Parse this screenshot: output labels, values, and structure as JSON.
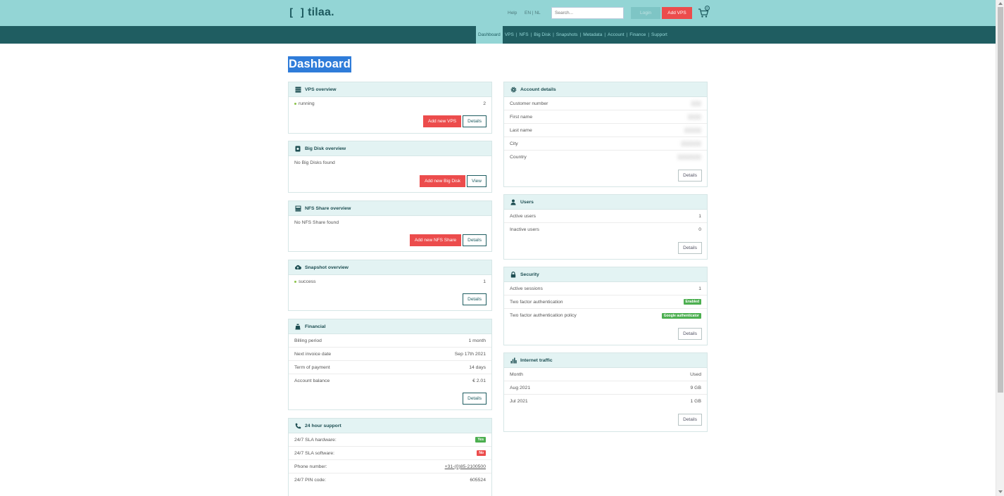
{
  "header": {
    "logo_text": "tilaa.",
    "help": "Help",
    "languages": "EN | NL",
    "search_placeholder": "Search...",
    "login_label": "Login",
    "add_vps_label": "Add VPS",
    "cart_count": "0"
  },
  "nav": {
    "items": [
      "Dashboard",
      "VPS",
      "NFS",
      "Big Disk",
      "Snapshots",
      "Metadata",
      "Account",
      "Finance",
      "Support"
    ]
  },
  "page": {
    "title": "Dashboard"
  },
  "vps": {
    "title": "VPS overview",
    "rows": [
      {
        "label": "running",
        "value": "2"
      }
    ],
    "add_label": "Add new VPS",
    "details_label": "Details"
  },
  "bigdisk": {
    "title": "Big Disk overview",
    "empty": "No Big Disks found",
    "add_label": "Add new Big Disk",
    "view_label": "View"
  },
  "nfs": {
    "title": "NFS Share overview",
    "empty": "No NFS Share found",
    "add_label": "Add new NFS Share",
    "details_label": "Details"
  },
  "snapshot": {
    "title": "Snapshot overview",
    "rows": [
      {
        "label": "success",
        "value": "1"
      }
    ],
    "details_label": "Details"
  },
  "financial": {
    "title": "Financial",
    "rows": [
      {
        "label": "Billing period",
        "value": "1 month"
      },
      {
        "label": "Next invoice date",
        "value": "Sep 17th 2021"
      },
      {
        "label": "Term of payment",
        "value": "14 days"
      },
      {
        "label": "Account balance",
        "value": "€ 2.01"
      }
    ],
    "details_label": "Details"
  },
  "support": {
    "title": "24 hour support",
    "rows": [
      {
        "label": "24/7 SLA hardware:",
        "value": "Yes"
      },
      {
        "label": "24/7 SLA software:",
        "value": "No"
      },
      {
        "label": "Phone number:",
        "value": "+31-(0)85-2100500"
      },
      {
        "label": "24/7 PIN code:",
        "value": "605524"
      }
    ]
  },
  "account": {
    "title": "Account details",
    "rows": [
      {
        "label": "Customer number",
        "value": ""
      },
      {
        "label": "First name",
        "value": ""
      },
      {
        "label": "Last name",
        "value": ""
      },
      {
        "label": "City",
        "value": ""
      },
      {
        "label": "Country",
        "value": ""
      }
    ],
    "details_label": "Details"
  },
  "users": {
    "title": "Users",
    "rows": [
      {
        "label": "Active users",
        "value": "1"
      },
      {
        "label": "Inactive users",
        "value": "0"
      }
    ],
    "details_label": "Details"
  },
  "security": {
    "title": "Security",
    "rows": [
      {
        "label": "Active sessions",
        "value": "1"
      },
      {
        "label": "Two factor authentication",
        "value": "Enabled"
      },
      {
        "label": "Two factor authentication policy",
        "value": "Google authenticator"
      }
    ],
    "details_label": "Details"
  },
  "traffic": {
    "title": "Internet traffic",
    "header": {
      "month": "Month",
      "used": "Used"
    },
    "rows": [
      {
        "month": "Aug 2021",
        "used": "9 GB"
      },
      {
        "month": "Jul 2021",
        "used": "1 GB"
      }
    ],
    "details_label": "Details"
  },
  "colors": {
    "header_bg": "#93d5d5",
    "nav_bg": "#1f5d61",
    "accent_red": "#ec4c4c",
    "title_highlight": "#2f7cd9",
    "card_head_bg": "#e3f3f3"
  }
}
